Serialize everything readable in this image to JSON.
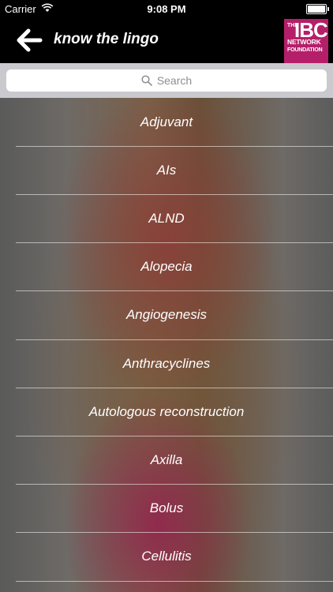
{
  "status": {
    "carrier": "Carrier",
    "time": "9:08 PM",
    "battery_level": 1.0
  },
  "header": {
    "title": "know the lingo",
    "back_icon": "back-arrow-icon"
  },
  "logo": {
    "line1": "THE",
    "line2": "IBC",
    "line3": "NETWORK",
    "line4": "FOUNDATION",
    "color": "#b51f6a"
  },
  "search": {
    "placeholder": "Search"
  },
  "terms": [
    "Adjuvant",
    "AIs",
    "ALND",
    "Alopecia",
    "Angiogenesis",
    "Anthracyclines",
    "Autologous reconstruction",
    "Axilla",
    "Bolus",
    "Cellulitis"
  ]
}
